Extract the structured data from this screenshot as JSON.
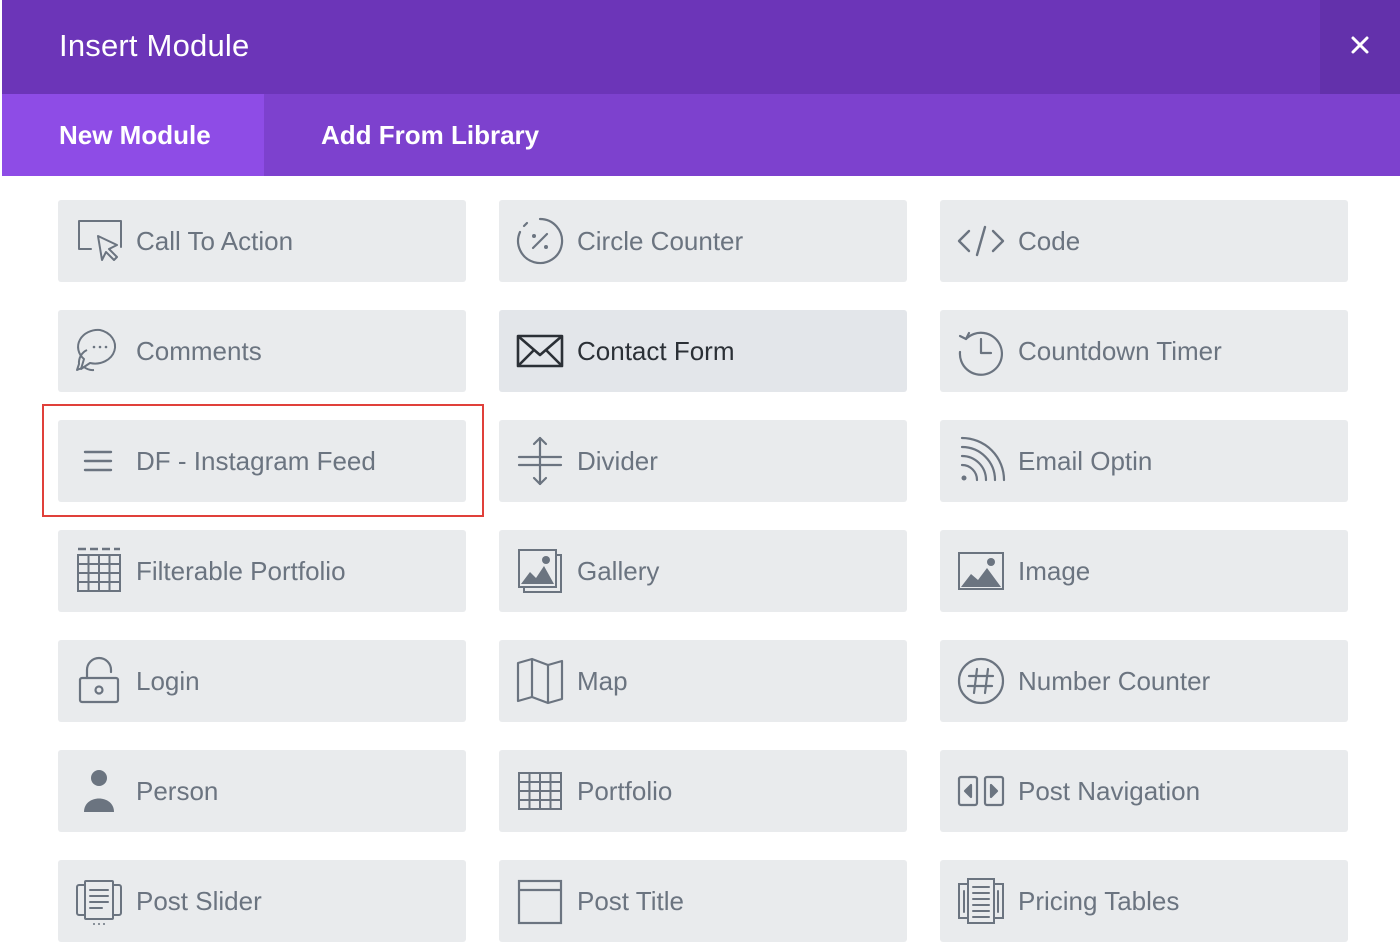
{
  "modal": {
    "title": "Insert Module",
    "close_symbol": "×"
  },
  "tabs": [
    {
      "label": "New Module",
      "active": true
    },
    {
      "label": "Add From Library",
      "active": false
    }
  ],
  "modules": [
    {
      "label": "Call To Action",
      "icon": "cursor-screen-icon"
    },
    {
      "label": "Circle Counter",
      "icon": "percent-circle-icon"
    },
    {
      "label": "Code",
      "icon": "code-icon"
    },
    {
      "label": "Comments",
      "icon": "chat-bubble-icon"
    },
    {
      "label": "Contact Form",
      "icon": "envelope-icon"
    },
    {
      "label": "Countdown Timer",
      "icon": "clock-history-icon"
    },
    {
      "label": "DF - Instagram Feed",
      "icon": "menu-lines-icon"
    },
    {
      "label": "Divider",
      "icon": "divider-arrows-icon"
    },
    {
      "label": "Email Optin",
      "icon": "rss-icon"
    },
    {
      "label": "Filterable Portfolio",
      "icon": "filter-grid-icon"
    },
    {
      "label": "Gallery",
      "icon": "gallery-icon"
    },
    {
      "label": "Image",
      "icon": "image-icon"
    },
    {
      "label": "Login",
      "icon": "lock-icon"
    },
    {
      "label": "Map",
      "icon": "map-icon"
    },
    {
      "label": "Number Counter",
      "icon": "hash-circle-icon"
    },
    {
      "label": "Person",
      "icon": "person-icon"
    },
    {
      "label": "Portfolio",
      "icon": "grid-icon"
    },
    {
      "label": "Post Navigation",
      "icon": "post-navigation-icon"
    },
    {
      "label": "Post Slider",
      "icon": "post-slider-icon"
    },
    {
      "label": "Post Title",
      "icon": "post-title-icon"
    },
    {
      "label": "Pricing Tables",
      "icon": "pricing-tables-icon"
    }
  ],
  "colors": {
    "header": "#6c35b8",
    "tab_bar": "#7d41ce",
    "active_tab": "#8e4ce6",
    "module_bg": "#e9ebed",
    "module_text": "#6b7480",
    "highlight": "#e0403a"
  }
}
